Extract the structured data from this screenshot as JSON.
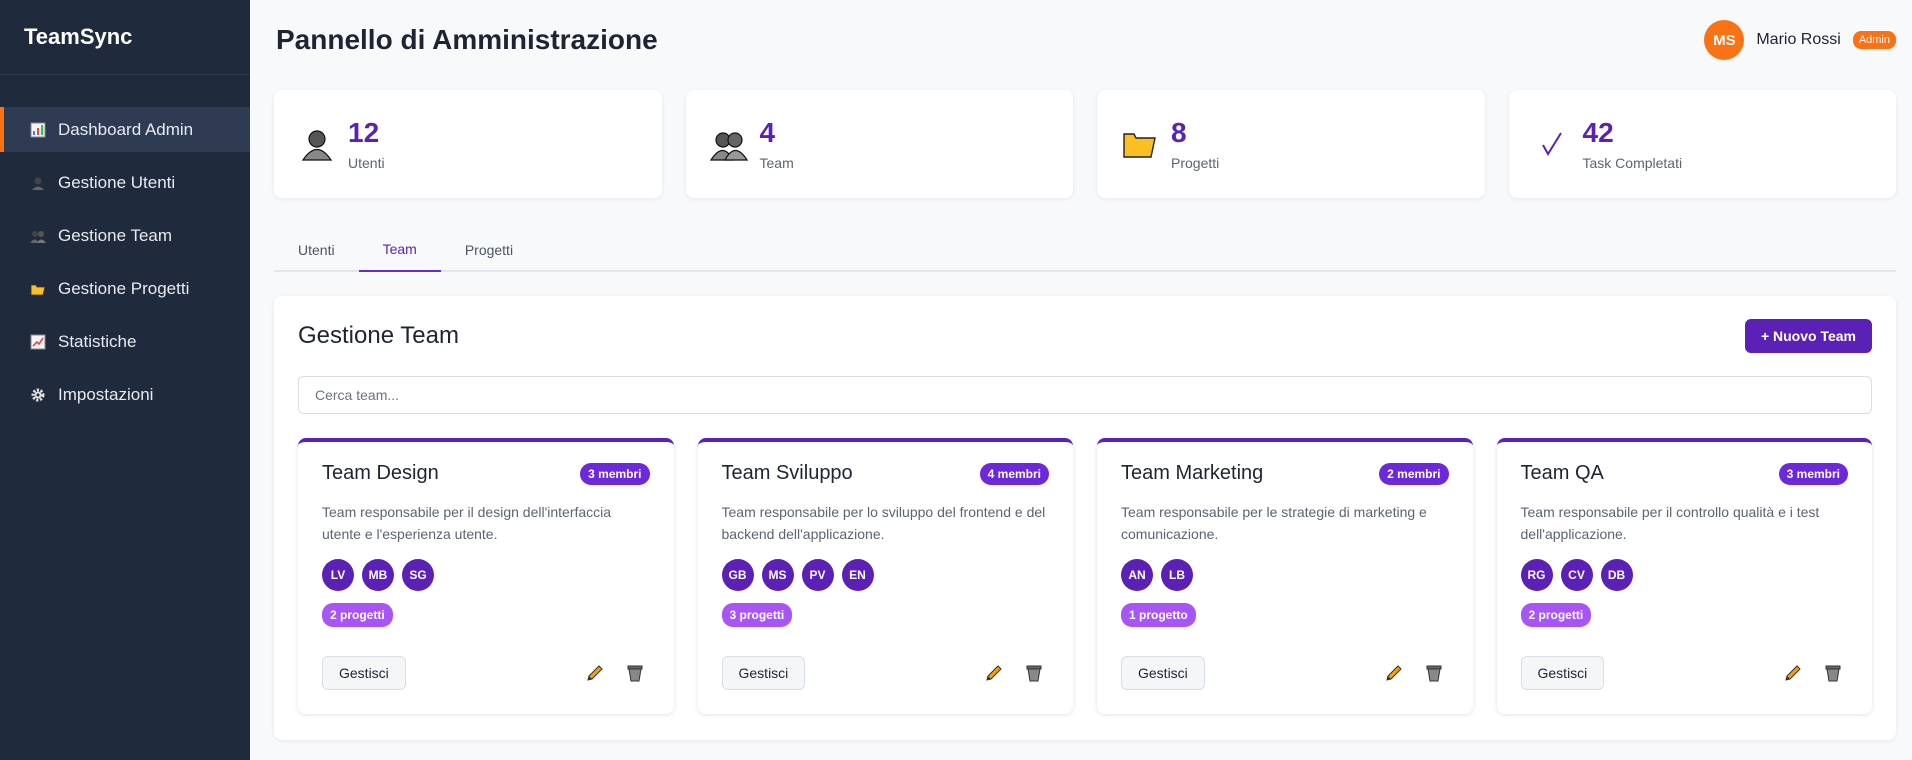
{
  "app": {
    "name": "TeamSync"
  },
  "sidebar": {
    "items": [
      {
        "label": "Dashboard Admin",
        "icon": "chart-icon",
        "active": true
      },
      {
        "label": "Gestione Utenti",
        "icon": "user-icon",
        "active": false
      },
      {
        "label": "Gestione Team",
        "icon": "users-icon",
        "active": false
      },
      {
        "label": "Gestione Progetti",
        "icon": "folder-icon",
        "active": false
      },
      {
        "label": "Statistiche",
        "icon": "trend-icon",
        "active": false
      },
      {
        "label": "Impostazioni",
        "icon": "gear-icon",
        "active": false
      }
    ]
  },
  "header": {
    "title": "Pannello di Amministrazione",
    "user": {
      "initials": "MS",
      "name": "Mario Rossi",
      "role": "Admin"
    }
  },
  "stats": [
    {
      "value": "12",
      "label": "Utenti",
      "icon": "user-icon"
    },
    {
      "value": "4",
      "label": "Team",
      "icon": "users-icon"
    },
    {
      "value": "8",
      "label": "Progetti",
      "icon": "folder-icon"
    },
    {
      "value": "42",
      "label": "Task Completati",
      "icon": "check-icon"
    }
  ],
  "tabs": [
    {
      "label": "Utenti",
      "active": false
    },
    {
      "label": "Team",
      "active": true
    },
    {
      "label": "Progetti",
      "active": false
    }
  ],
  "panel": {
    "title": "Gestione Team",
    "new_button": "+ Nuovo Team",
    "search_placeholder": "Cerca team..."
  },
  "teams": [
    {
      "name": "Team Design",
      "members_label": "3 membri",
      "description": "Team responsabile per il design dell'interfaccia utente e l'esperienza utente.",
      "members": [
        "LV",
        "MB",
        "SG"
      ],
      "projects_label": "2 progetti",
      "manage_label": "Gestisci"
    },
    {
      "name": "Team Sviluppo",
      "members_label": "4 membri",
      "description": "Team responsabile per lo sviluppo del frontend e del backend dell'applicazione.",
      "members": [
        "GB",
        "MS",
        "PV",
        "EN"
      ],
      "projects_label": "3 progetti",
      "manage_label": "Gestisci"
    },
    {
      "name": "Team Marketing",
      "members_label": "2 membri",
      "description": "Team responsabile per le strategie di marketing e comunicazione.",
      "members": [
        "AN",
        "LB"
      ],
      "projects_label": "1 progetto",
      "manage_label": "Gestisci"
    },
    {
      "name": "Team QA",
      "members_label": "3 membri",
      "description": "Team responsabile per il controllo qualità e i test dell'applicazione.",
      "members": [
        "RG",
        "CV",
        "DB"
      ],
      "projects_label": "2 progetti",
      "manage_label": "Gestisci"
    }
  ],
  "colors": {
    "primary": "#5b21b6",
    "accent": "#f97316",
    "sidebar": "#1f2a3c",
    "project_badge": "#a855f7"
  }
}
